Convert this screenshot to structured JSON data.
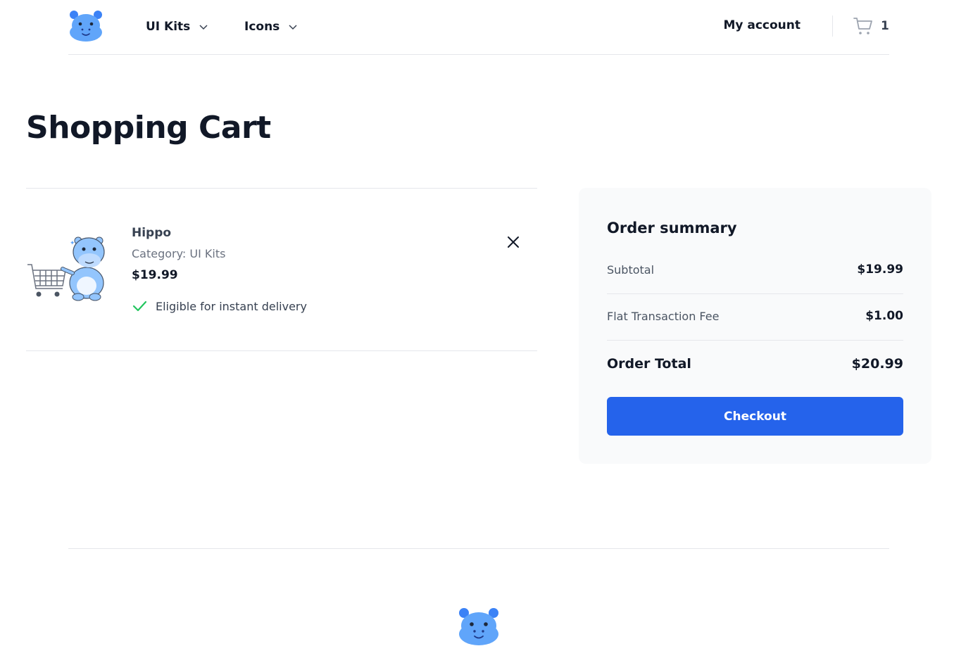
{
  "header": {
    "logo_icon": "hippo-logo-icon",
    "nav": [
      {
        "label": "UI Kits"
      },
      {
        "label": "Icons"
      }
    ],
    "account_label": "My account",
    "cart_count": "1"
  },
  "page": {
    "title": "Shopping Cart"
  },
  "cart": {
    "items": [
      {
        "name": "Hippo",
        "category": "Category: UI Kits",
        "price": "$19.99",
        "delivery": "Eligible for instant delivery"
      }
    ]
  },
  "summary": {
    "title": "Order summary",
    "subtotal_label": "Subtotal",
    "subtotal_value": "$19.99",
    "fee_label": "Flat Transaction Fee",
    "fee_value": "$1.00",
    "total_label": "Order Total",
    "total_value": "$20.99",
    "checkout_label": "Checkout"
  },
  "colors": {
    "accent": "#2563eb",
    "check": "#22c55e",
    "hippo": "#60a5fa"
  }
}
